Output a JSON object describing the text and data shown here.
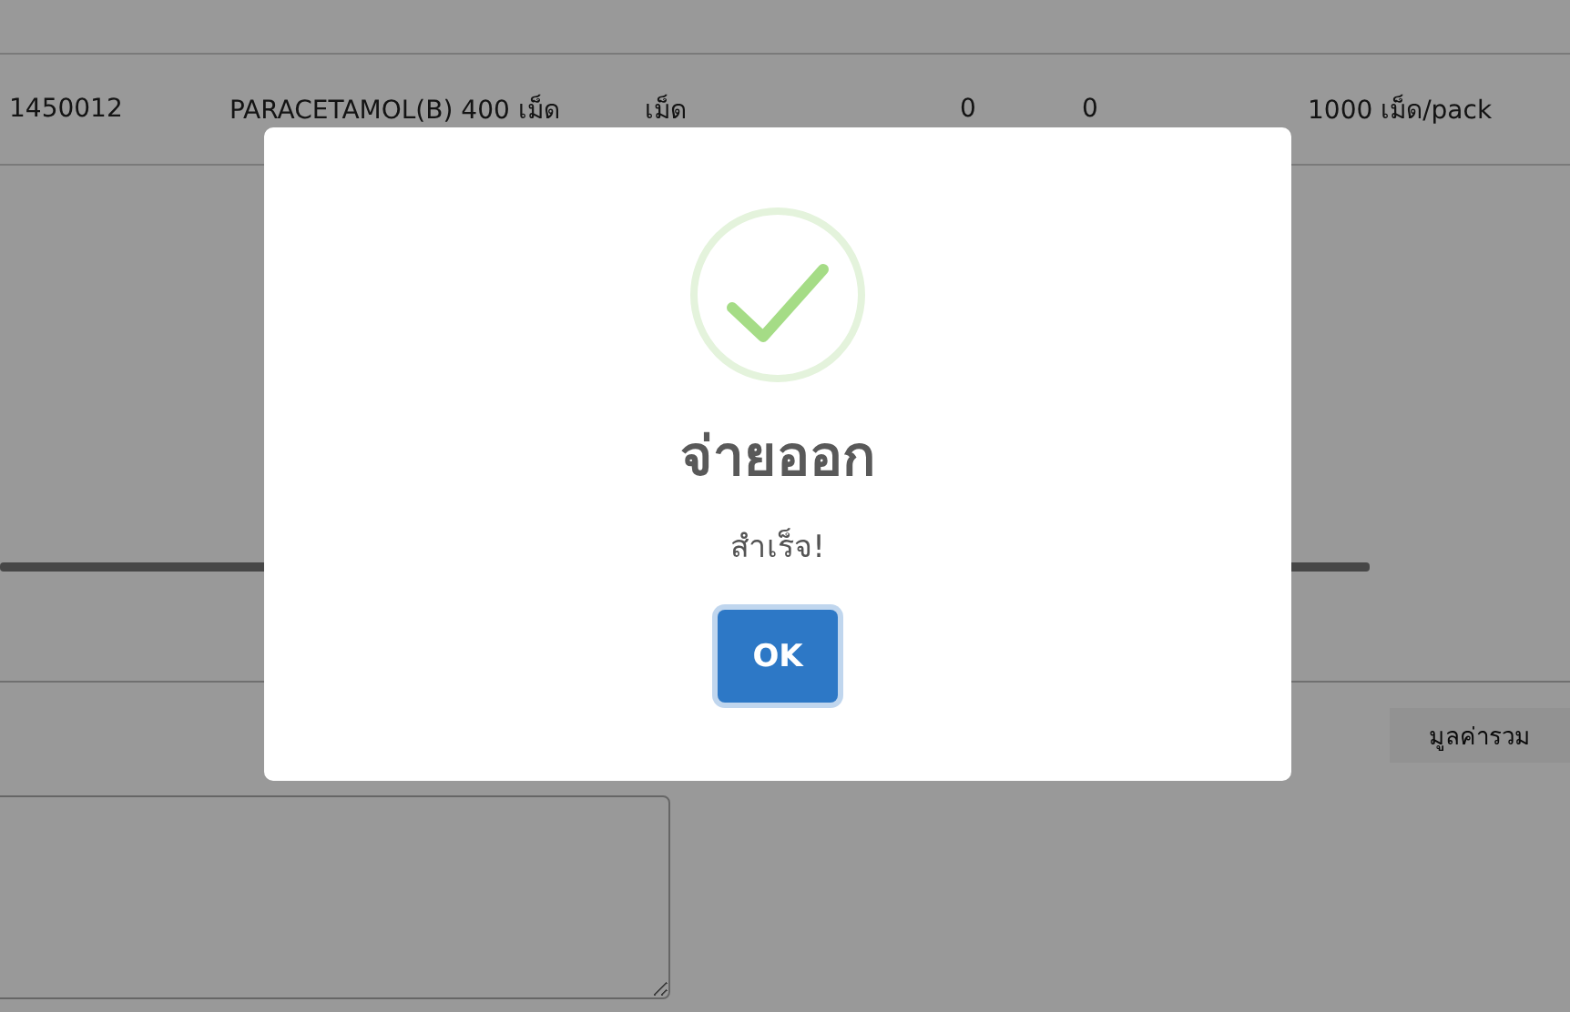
{
  "table": {
    "rows": [
      {
        "cells": [
          "1450012",
          "PARACETAMOL(B) 400 เม็ด",
          "เม็ด",
          "0",
          "0",
          "1000 เม็ด/pack"
        ]
      }
    ]
  },
  "total_label": "มูลค่ารวม",
  "dialog": {
    "title": "จ่ายออก",
    "message": "สำเร็จ!",
    "button": "OK"
  }
}
